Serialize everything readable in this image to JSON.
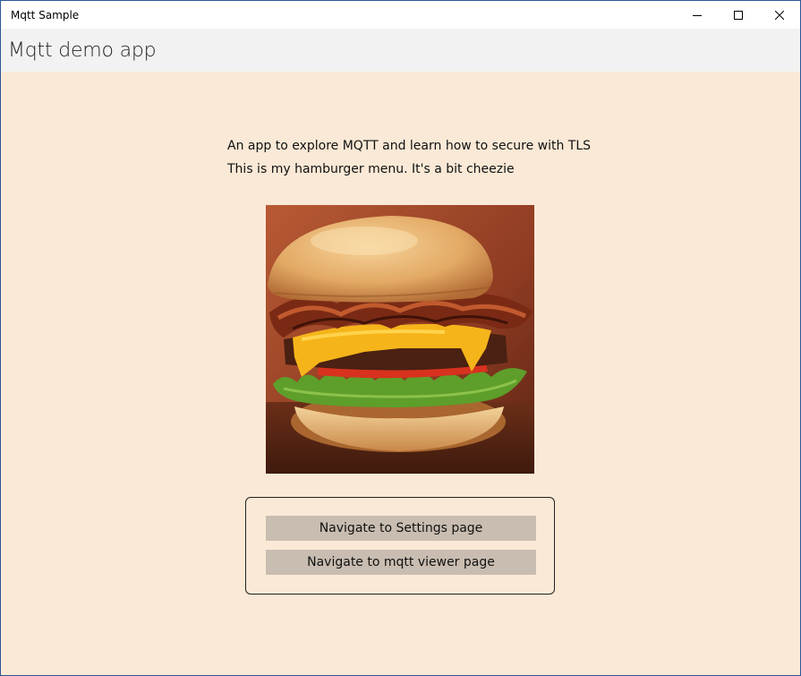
{
  "window": {
    "title": "Mqtt Sample",
    "controls": {
      "minimize": "minimize-icon",
      "maximize": "maximize-icon",
      "close": "close-icon"
    }
  },
  "header": {
    "title": "Mqtt demo app"
  },
  "main": {
    "description_line1": "An app to explore MQTT and learn how to secure with TLS",
    "description_line2": "This is my hamburger menu. It's a bit cheezie",
    "image": "hamburger-image",
    "buttons": {
      "settings": "Navigate to Settings page",
      "viewer": "Navigate to mqtt viewer page"
    }
  },
  "colors": {
    "page_background": "#fae9d6",
    "header_background": "#f2f2f2",
    "button_background": "#c8bdb0",
    "window_border": "#2b5797"
  }
}
